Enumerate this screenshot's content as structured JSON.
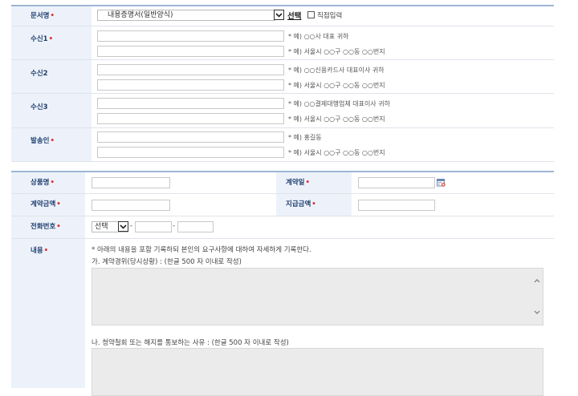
{
  "doc": {
    "label": "문서명",
    "selected": "내용증명서(일반양식)",
    "select_link": "선택",
    "direct_label": "직접입력"
  },
  "recipients": [
    {
      "label": "수신1",
      "required": true,
      "ex1": "* 예) ○○사 대표 귀하",
      "ex2": "* 예) 서울시 ○○구 ○○동 ○○번지"
    },
    {
      "label": "수신2",
      "required": false,
      "ex1": "* 예) ○○신용카드사 대표이사 귀하",
      "ex2": "* 예) 서울시 ○○구 ○○동 ○○번지"
    },
    {
      "label": "수신3",
      "required": false,
      "ex1": "* 예) ○○결제대행업체 대표이사 귀하",
      "ex2": "* 예) 서울시 ○○구 ○○동 ○○번지"
    },
    {
      "label": "발송인",
      "required": true,
      "ex1": "* 예) 홍길동",
      "ex2": "* 예) 서울시 ○○구 ○○동 ○○번지"
    }
  ],
  "form": {
    "product": "상품명",
    "contract_date": "계약일",
    "contract_amount": "계약금액",
    "paid_amount": "지급금액",
    "phone": "전화번호",
    "phone_select": "선택",
    "dash": "-",
    "content": "내용"
  },
  "content": {
    "note": "* 아래의 내용을 포함 기록하되 본인의 요구사항에 대하여 자세하게 기록한다.",
    "section_a": "가. 계약경위(당시상황) : (한글 500 자 이내로 작성)",
    "section_b": "나. 청약철회 또는 해지를 통보하는 사유 : (한글 500 자 이내로 작성)"
  },
  "required_mark": "•"
}
